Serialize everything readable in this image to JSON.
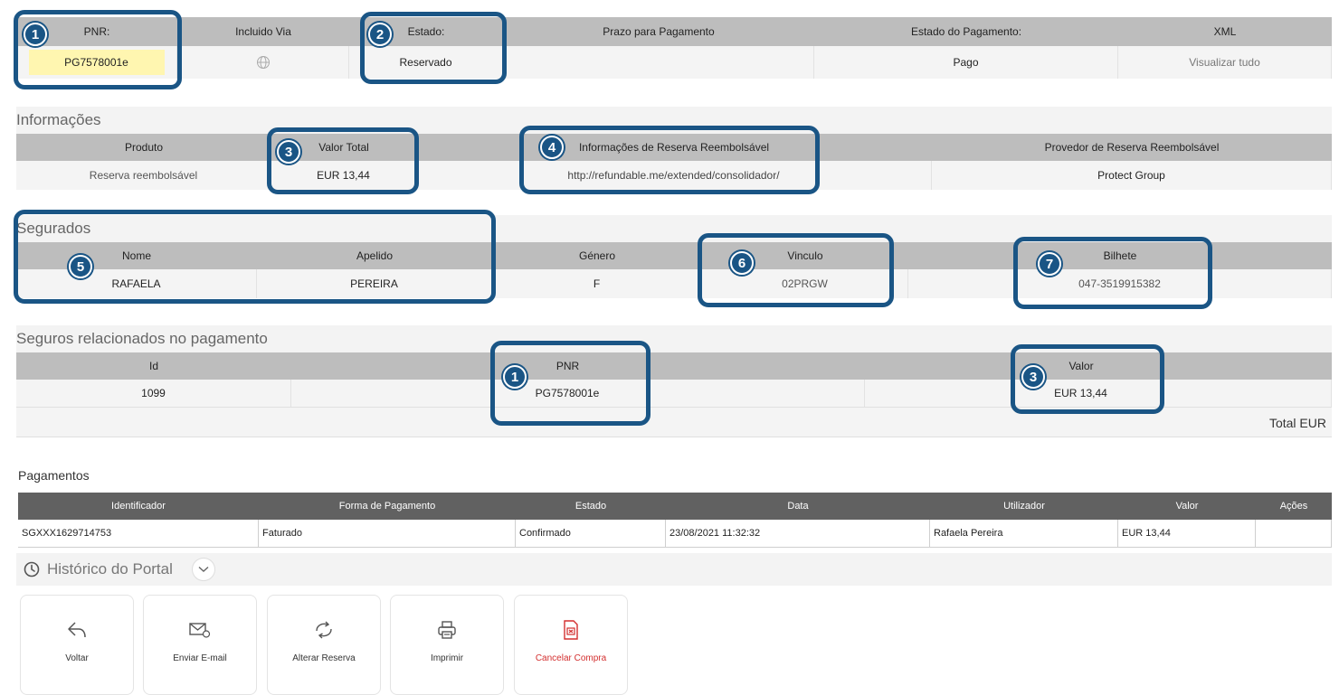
{
  "top": {
    "headers": [
      "PNR:",
      "Incluido Via",
      "Estado:",
      "Prazo para Pagamento",
      "Estado do Pagamento:",
      "XML"
    ],
    "pnr": "PG7578001e",
    "estado": "Reservado",
    "prazo": "",
    "estado_pagamento": "Pago",
    "xml_link": "Visualizar tudo"
  },
  "info": {
    "title": "Informações",
    "headers": [
      "Produto",
      "Valor Total",
      "Informações de Reserva Reembolsável",
      "Provedor de Reserva Reembolsável"
    ],
    "values": [
      "Reserva reembolsável",
      "EUR 13,44",
      "http://refundable.me/extended/consolidador/",
      "Protect Group"
    ]
  },
  "segurados": {
    "title": "Segurados",
    "headers": [
      "Nome",
      "Apelido",
      "Género",
      "Vinculo",
      "Bilhete"
    ],
    "values": [
      "RAFAELA",
      "PEREIRA",
      "F",
      "02PRGW",
      "047-3519915382"
    ]
  },
  "seguros": {
    "title": "Seguros relacionados no pagamento",
    "headers": [
      "Id",
      "PNR",
      "Valor"
    ],
    "values": [
      "1099",
      "PG7578001e",
      "EUR 13,44"
    ],
    "total_label": "Total EUR"
  },
  "pagamentos": {
    "title": "Pagamentos",
    "headers": [
      "Identificador",
      "Forma de Pagamento",
      "Estado",
      "Data",
      "Utilizador",
      "Valor",
      "Ações"
    ],
    "row": [
      "SGXXX1629714753",
      "Faturado",
      "Confirmado",
      "23/08/2021 11:32:32",
      "Rafaela Pereira",
      "EUR 13,44",
      ""
    ]
  },
  "historico": {
    "label": "Histórico do Portal",
    "icon": "clock-icon",
    "toggle_icon": "chevron-down-icon"
  },
  "actions": [
    {
      "label": "Voltar",
      "icon": "back-arrow-icon"
    },
    {
      "label": "Enviar E-mail",
      "icon": "email-icon"
    },
    {
      "label": "Alterar Reserva",
      "icon": "exchange-icon"
    },
    {
      "label": "Imprimir",
      "icon": "printer-icon"
    },
    {
      "label": "Cancelar Compra",
      "icon": "cancel-document-icon",
      "color": "#d32f2f"
    }
  ],
  "callouts": [
    "1",
    "2",
    "3",
    "4",
    "5",
    "6",
    "7",
    "1",
    "3"
  ],
  "colors": {
    "callout": "#1a5585",
    "pnr_highlight": "#fff6b0",
    "cancel": "#d32f2f",
    "header_gray": "#bdbdbd",
    "payments_header": "#616161"
  }
}
